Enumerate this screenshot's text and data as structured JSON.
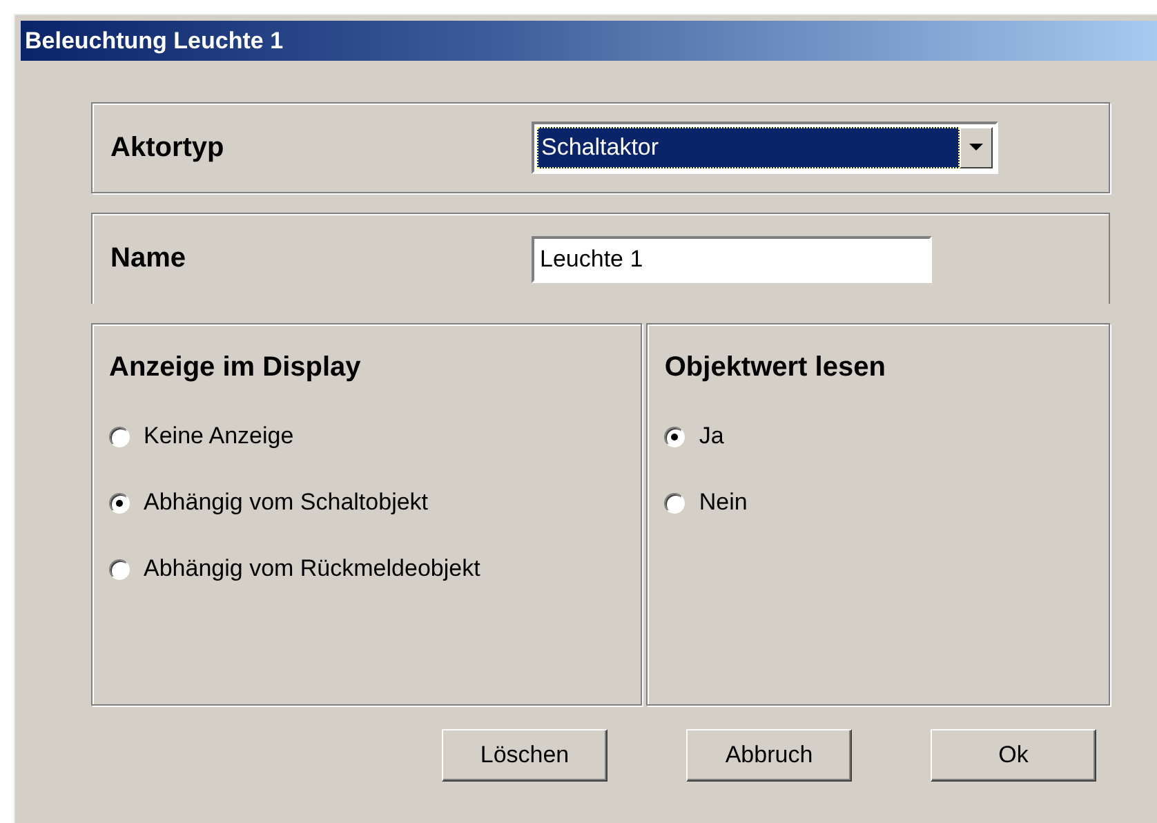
{
  "window": {
    "title": "Beleuchtung Leuchte 1"
  },
  "aktortyp": {
    "label": "Aktortyp",
    "value": "Schaltaktor"
  },
  "name": {
    "label": "Name",
    "value": "Leuchte 1"
  },
  "groups": [
    {
      "title": "Anzeige im Display",
      "options": [
        {
          "label": "Keine Anzeige",
          "selected": false
        },
        {
          "label": "Abhängig vom Schaltobjekt",
          "selected": true
        },
        {
          "label": "Abhängig vom Rückmeldeobjekt",
          "selected": false
        }
      ]
    },
    {
      "title": "Objektwert lesen",
      "options": [
        {
          "label": "Ja",
          "selected": true
        },
        {
          "label": "Nein",
          "selected": false
        }
      ]
    }
  ],
  "buttons": [
    "Löschen",
    "Abbruch",
    "Ok"
  ]
}
